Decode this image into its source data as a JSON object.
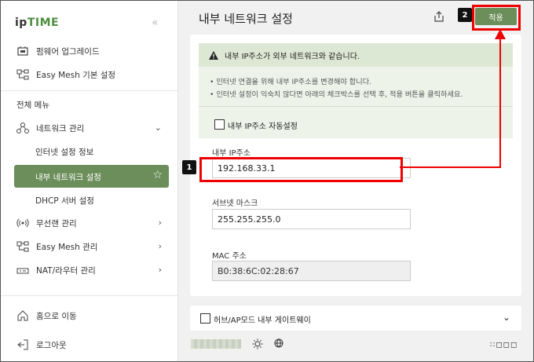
{
  "brand": {
    "prefix": "ip",
    "suffix": "TIME"
  },
  "sidebar": {
    "top_items": [
      {
        "label": "펌웨어 업그레이드",
        "icon": "firmware-icon"
      },
      {
        "label": "Easy Mesh 기본 설정",
        "icon": "mesh-icon"
      }
    ],
    "section_label": "전체 메뉴",
    "network_group": {
      "label": "네트워크 관리",
      "icon": "network-icon"
    },
    "sub_items": [
      {
        "label": "인터넷 설정 정보"
      },
      {
        "label": "내부 네트워크 설정",
        "active": true
      },
      {
        "label": "DHCP 서버 설정"
      }
    ],
    "more_items": [
      {
        "label": "무선랜 관리",
        "icon": "wireless-icon"
      },
      {
        "label": "Easy Mesh 관리",
        "icon": "mesh-icon"
      },
      {
        "label": "NAT/라우터 관리",
        "icon": "router-icon"
      }
    ],
    "bottom_items": [
      {
        "label": "홈으로 이동",
        "icon": "home-icon"
      },
      {
        "label": "로그아웃",
        "icon": "logout-icon"
      }
    ]
  },
  "header": {
    "title": "내부 네트워크 설정",
    "apply_label": "적용"
  },
  "notice": {
    "heading": "내부 IP주소가 외부 네트워크와 같습니다.",
    "lines": [
      "• 인터넷 연결을 위해 내부 IP주소를 변경해야 합니다.",
      "• 인터넷 설정이 익숙치 않다면 아래의 체크박스를 선택 후, 적용 버튼을 클릭하세요."
    ],
    "auto_checkbox_label": "내부 IP주소 자동설정"
  },
  "form": {
    "ip_label": "내부 IP주소",
    "ip_value": "192.168.33.1",
    "subnet_label": "서브넷 마스크",
    "subnet_value": "255.255.255.0",
    "mac_label": "MAC 주소",
    "mac_value": "B0:38:6C:02:28:67"
  },
  "hub_section": {
    "label": "허브/AP모드 내부 게이트웨이"
  },
  "annotations": {
    "step1": "1",
    "step2": "2"
  },
  "colors": {
    "accent": "#6b8e5a",
    "highlight": "#e00000"
  }
}
